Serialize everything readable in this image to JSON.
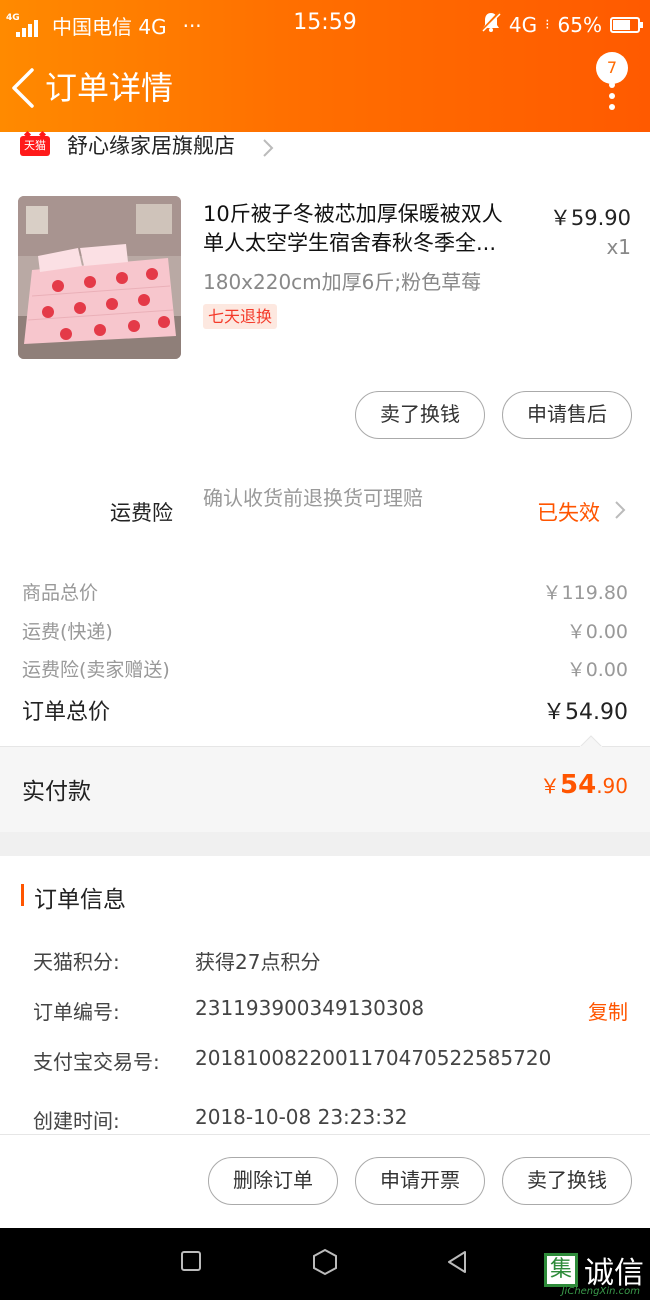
{
  "status_bar": {
    "network_type": "4G",
    "carrier": "中国电信 4G",
    "more": "···",
    "time": "15:59",
    "network_right": "4G",
    "battery": "65%"
  },
  "header": {
    "title": "订单详情",
    "badge_count": "7"
  },
  "shop": {
    "badge": "天猫",
    "name": "舒心缘家居旗舰店"
  },
  "product": {
    "title_line1": "10斤被子冬被芯加厚保暖被双人",
    "title_line2": "单人太空学生宿舍春秋冬季全...",
    "sku": "180x220cm加厚6斤;粉色草莓",
    "tag": "七天退换",
    "price": "￥59.90",
    "quantity": "x1"
  },
  "item_actions": {
    "sell": "卖了换钱",
    "after_sale": "申请售后"
  },
  "insurance": {
    "label": "运费险",
    "description": "确认收货前退换货可理赔",
    "status": "已失效"
  },
  "price_rows": [
    {
      "label": "商品总价",
      "value": "￥119.80"
    },
    {
      "label": "运费(快递)",
      "value": "￥0.00"
    },
    {
      "label": "运费险(卖家赠送)",
      "value": "￥0.00"
    },
    {
      "label": "订单总价",
      "value": "￥54.90"
    }
  ],
  "paid": {
    "label": "实付款",
    "currency": "￥",
    "integer": "54",
    "decimal": ".90"
  },
  "order_info": {
    "title": "订单信息",
    "rows": [
      {
        "key": "天猫积分:",
        "value": "获得27点积分"
      },
      {
        "key": "订单编号:",
        "value": "231193900349130308"
      },
      {
        "key": "支付宝交易号:",
        "value": "2018100822001170470522585720"
      },
      {
        "key": "创建时间:",
        "value": "2018-10-08 23:23:32"
      }
    ],
    "copy": "复制"
  },
  "bottom_actions": {
    "delete": "删除订单",
    "invoice": "申请开票",
    "sell": "卖了换钱"
  },
  "watermark": {
    "box": "集",
    "text": "诚信",
    "sub": "JiChengXin.com"
  },
  "colors": {
    "accent": "#ff5500",
    "header_start": "#ff8a00",
    "header_end": "#ff5a00"
  }
}
